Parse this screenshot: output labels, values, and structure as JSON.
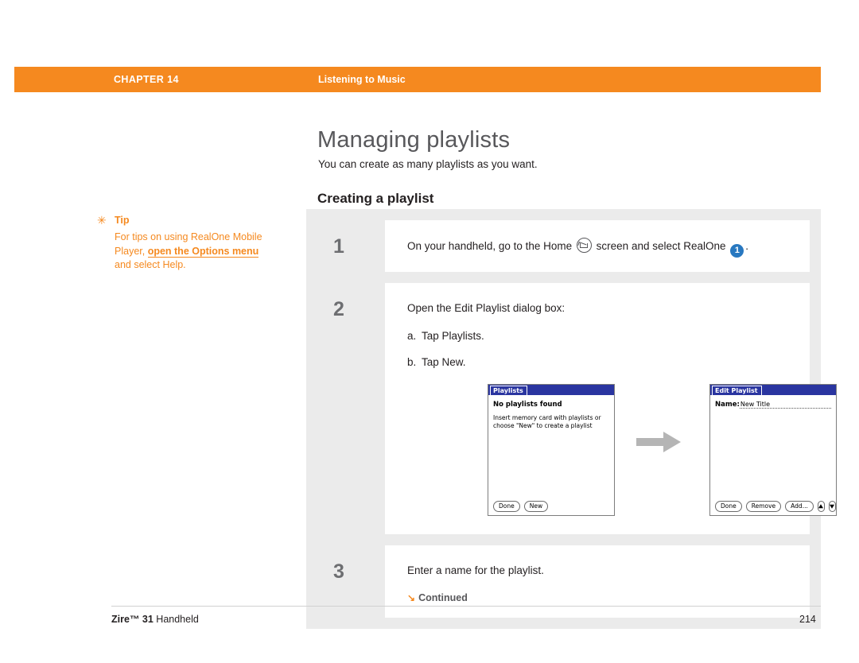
{
  "header": {
    "chapter": "CHAPTER 14",
    "title": "Listening to Music"
  },
  "page": {
    "title": "Managing playlists",
    "subtitle": "You can create as many playlists as you want.",
    "section": "Creating a playlist"
  },
  "tip": {
    "star": "✳",
    "label": "Tip",
    "line1": "For tips on using RealOne",
    "line2a": "Mobile Player, ",
    "line2b": "open the ",
    "line3a": "Options menu",
    "line3b": " and select",
    "line4": "Help."
  },
  "steps": [
    {
      "number": "1",
      "text_before": "On your handheld, go to the Home",
      "text_middle": "screen and select RealOne",
      "text_after": ".",
      "home_icon": "home-icon",
      "realone_badge": "1"
    },
    {
      "number": "2",
      "text": "Open the Edit Playlist dialog box:",
      "sub_steps": [
        {
          "label": "a.",
          "text": "Tap Playlists."
        },
        {
          "label": "b.",
          "text": "Tap New."
        }
      ],
      "screens": {
        "left": {
          "titlebar": "Playlists",
          "heading": "No playlists found",
          "body": "Insert memory card with playlists or choose \"New\" to create a playlist",
          "buttons": [
            "Done",
            "New"
          ]
        },
        "right": {
          "titlebar": "Edit Playlist",
          "name_label": "Name:",
          "name_value": "New Title",
          "buttons": [
            "Done",
            "Remove",
            "Add..."
          ],
          "arrow_up": "▲",
          "arrow_down": "▼"
        }
      }
    },
    {
      "number": "3",
      "text": "Enter a name for the playlist.",
      "continued_glyph": "↘",
      "continued": "Continued"
    }
  ],
  "footer": {
    "product_bold": "Zire™ 31",
    "product_rest": " Handheld",
    "page_number": "214"
  },
  "colors": {
    "accent_orange": "#f5891f",
    "title_gray": "#58585b",
    "panel_gray": "#ebebeb",
    "palm_blue": "#2a35a0",
    "badge_blue": "#2878c0"
  }
}
